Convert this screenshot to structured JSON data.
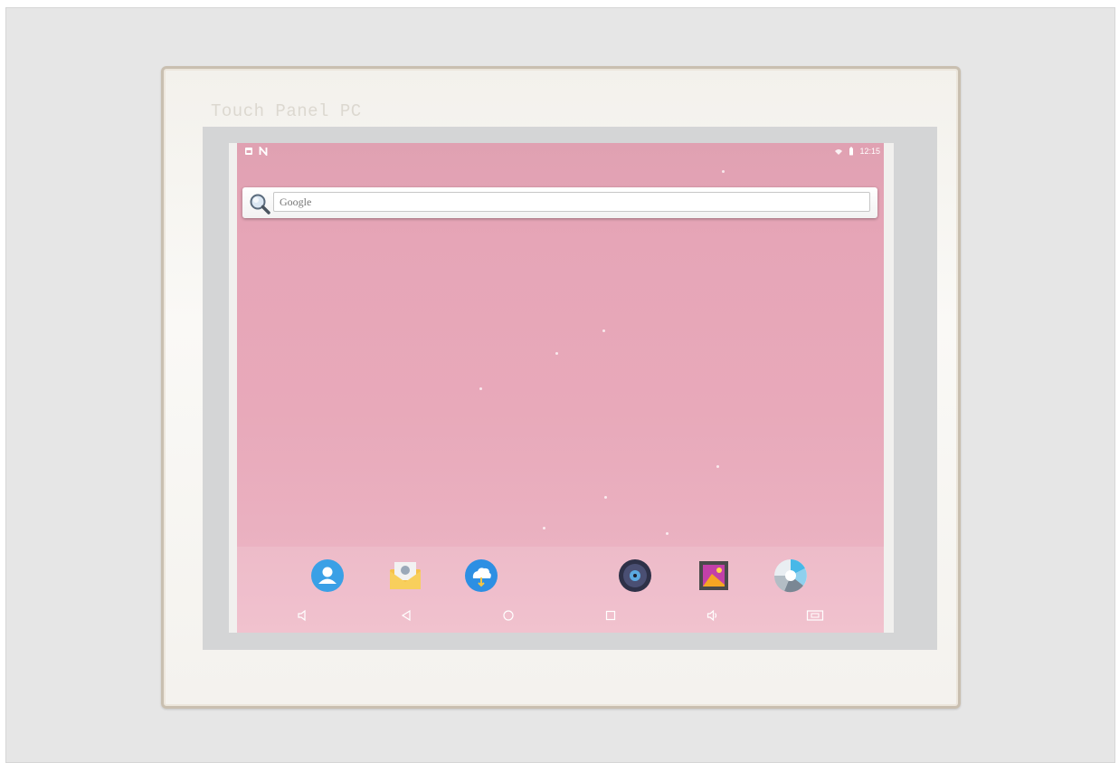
{
  "device": {
    "brand_label": "Touch Panel PC"
  },
  "status_bar": {
    "time": "12:15",
    "left_icons": [
      "gallery-notification-icon",
      "n-notification-icon"
    ],
    "right_icons": [
      "wifi-icon",
      "battery-icon"
    ]
  },
  "search": {
    "placeholder": "Google"
  },
  "dock": {
    "apps": [
      {
        "name": "contacts-app",
        "icon": "contacts-icon",
        "color": "#3aa0e6"
      },
      {
        "name": "email-app",
        "icon": "email-icon",
        "color": "#f6c24a"
      },
      {
        "name": "cloud-download-app",
        "icon": "cloud-download-icon",
        "color": "#2d8fe3"
      },
      {
        "name": "music-app",
        "icon": "music-icon",
        "color": "#3b3f5c"
      },
      {
        "name": "gallery-app",
        "icon": "gallery-icon",
        "color": "#9c3bb5"
      },
      {
        "name": "camera-app",
        "icon": "camera-icon",
        "color": "#48b8e8"
      }
    ]
  },
  "navigation": {
    "buttons": [
      "volume-down",
      "back",
      "home",
      "recents",
      "volume-up",
      "screenshot"
    ]
  },
  "colors": {
    "wallpaper": "#e8a9ba",
    "bezel": "#f4f2ee",
    "bezel_border": "#c9bfb0"
  }
}
